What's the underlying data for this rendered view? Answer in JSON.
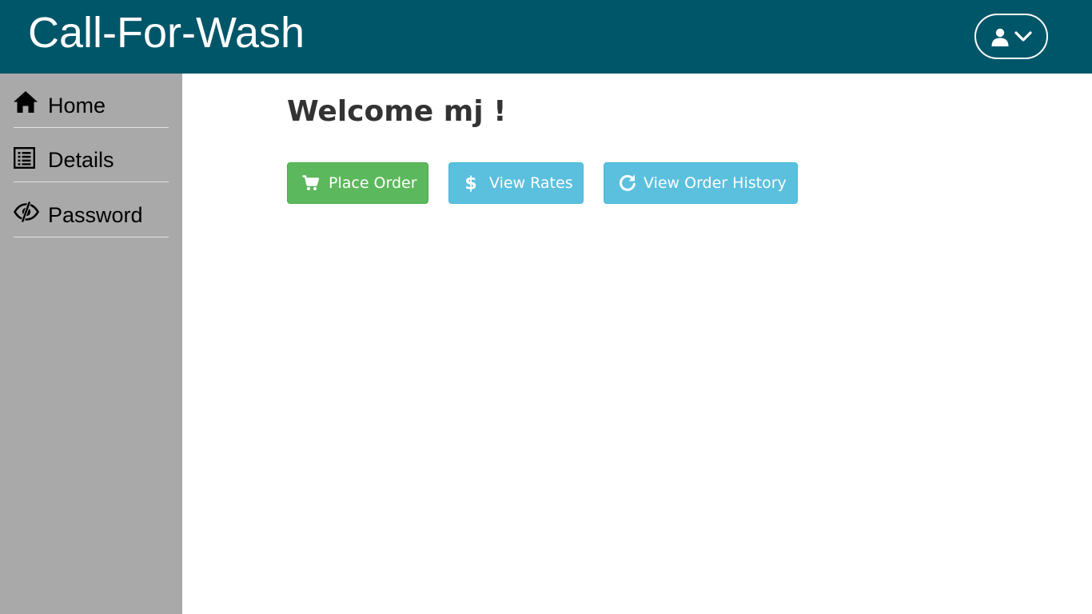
{
  "header": {
    "title": "Call-For-Wash",
    "user_menu": {
      "user_icon": "user-icon",
      "chevron_icon": "chevron-down-icon"
    }
  },
  "sidebar": {
    "items": [
      {
        "label": "Home",
        "icon": "home-icon"
      },
      {
        "label": "Details",
        "icon": "list-icon"
      },
      {
        "label": "Password",
        "icon": "eye-slash-icon"
      }
    ]
  },
  "main": {
    "welcome": "Welcome mj !",
    "actions": [
      {
        "label": "Place Order",
        "icon": "shopping-cart-icon"
      },
      {
        "label": "View Rates",
        "icon": "dollar-icon"
      },
      {
        "label": "View Order History",
        "icon": "refresh-icon"
      }
    ]
  },
  "colors": {
    "header": "#005669",
    "sidebar": "#a9a9a9",
    "success_button": "#5cb85c",
    "info_button": "#5bc0de",
    "heading_text": "#333333"
  }
}
